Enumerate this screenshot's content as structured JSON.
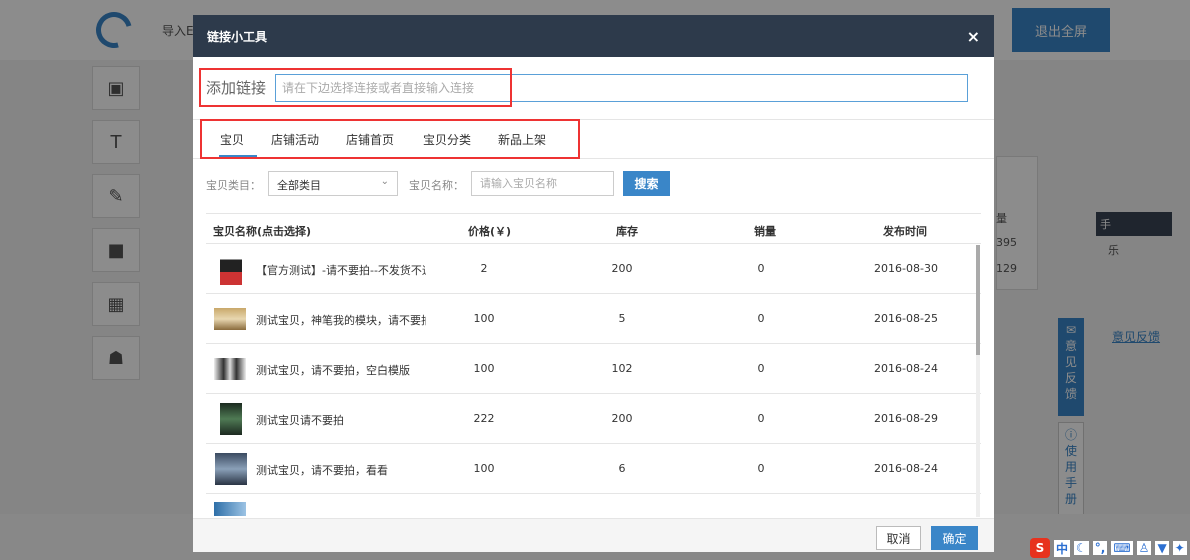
{
  "background": {
    "import_label": "导入E",
    "exit_fullscreen": "退出全屏",
    "right_panel": {
      "r1": "量",
      "r2": "395",
      "r3": "129",
      "dark_bar": "手",
      "dark_bar_sub": "乐"
    },
    "feedback_link": "意见反馈",
    "side_feedback": "意见反馈",
    "side_help": "使用手册"
  },
  "modal": {
    "title": "链接小工具",
    "close_symbol": "×",
    "link_label": "添加链接",
    "link_placeholder": "请在下边选择连接或者直接输入连接",
    "tabs": [
      "宝贝",
      "店铺活动",
      "店铺首页",
      "宝贝分类",
      "新品上架"
    ],
    "filter": {
      "category_label": "宝贝类目：",
      "category_value": "全部类目",
      "name_label": "宝贝名称：",
      "name_placeholder": "请输入宝贝名称",
      "search_button": "搜索"
    },
    "table": {
      "headers": [
        "宝贝名称(点击选择)",
        "价格(￥)",
        "库存",
        "销量",
        "发布时间"
      ],
      "rows": [
        {
          "name": "【官方测试】-请不要拍--不发货不退",
          "price": "2",
          "stock": "200",
          "sales": "0",
          "date": "2016-08-30"
        },
        {
          "name": "测试宝贝，神笔我的模块，请不要拍",
          "price": "100",
          "stock": "5",
          "sales": "0",
          "date": "2016-08-25"
        },
        {
          "name": "测试宝贝，请不要拍，空白模版",
          "price": "100",
          "stock": "102",
          "sales": "0",
          "date": "2016-08-24"
        },
        {
          "name": "测试宝贝请不要拍",
          "price": "222",
          "stock": "200",
          "sales": "0",
          "date": "2016-08-29"
        },
        {
          "name": "测试宝贝，请不要拍，看看",
          "price": "100",
          "stock": "6",
          "sales": "0",
          "date": "2016-08-24"
        }
      ]
    },
    "footer": {
      "cancel": "取消",
      "confirm": "确定"
    }
  },
  "ime": {
    "logo": "S",
    "label": "中"
  }
}
